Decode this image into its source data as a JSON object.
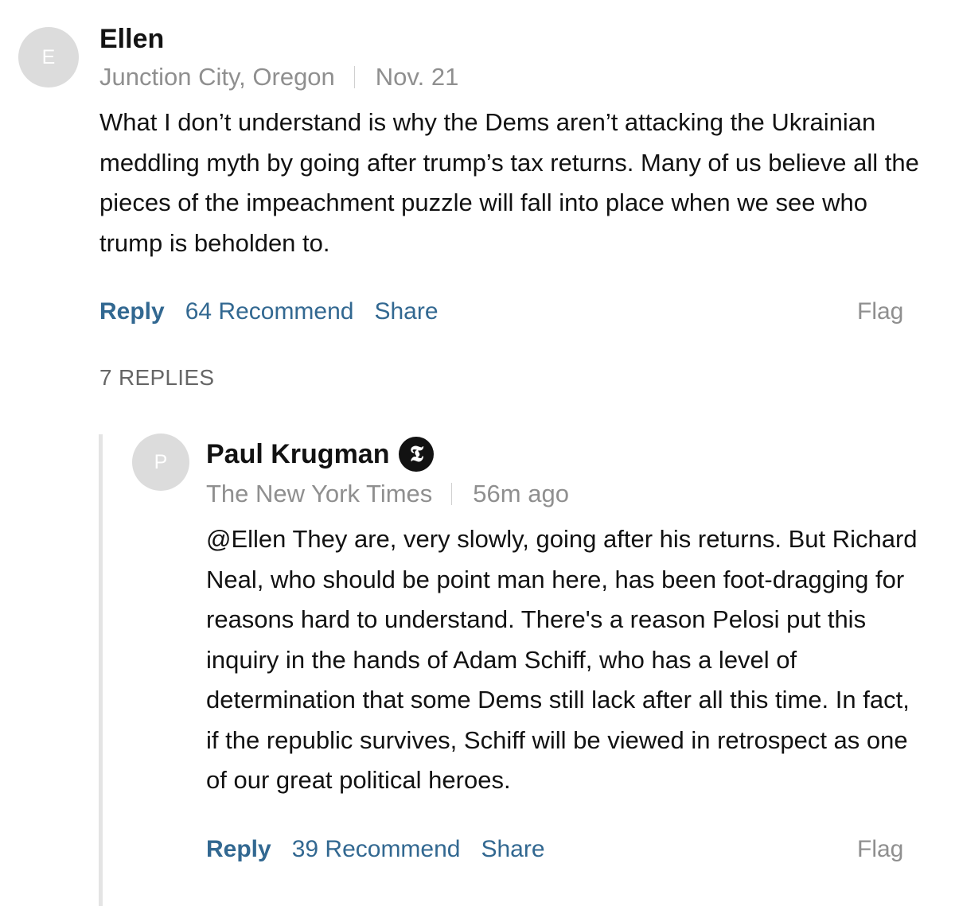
{
  "comment": {
    "avatar_initial": "E",
    "author": "Ellen",
    "location": "Junction City, Oregon",
    "date": "Nov. 21",
    "body": "What I don’t understand is why the Dems aren’t attacking the Ukrainian meddling myth by going after trump’s tax returns. Many of us believe all the pieces of the impeachment puzzle will fall into place when we see who trump is beholden to.",
    "reply_label": "Reply",
    "recommend_label": "64 Recommend",
    "share_label": "Share",
    "flag_label": "Flag"
  },
  "replies_count": "7 REPLIES",
  "reply": {
    "avatar_initial": "P",
    "author": "Paul Krugman",
    "badge_glyph": "𝕿",
    "badge_icon": "nyt-logo-icon",
    "affiliation": "The New York Times",
    "time": "56m ago",
    "body": "@Ellen They are, very slowly, going after his returns. But Richard Neal, who should be point man here, has been foot-dragging for reasons hard to understand. There's a reason Pelosi put this inquiry in the hands of Adam Schiff, who has a level of determination that some Dems still lack after all this time. In fact, if the republic survives, Schiff will be viewed in retrospect as one of our great political heroes.",
    "reply_label": "Reply",
    "recommend_label": "39 Recommend",
    "share_label": "Share",
    "flag_label": "Flag"
  },
  "colors": {
    "link": "#326891",
    "muted": "#8f8f8f",
    "avatar_bg": "#dcdcdc",
    "text": "#121212"
  }
}
